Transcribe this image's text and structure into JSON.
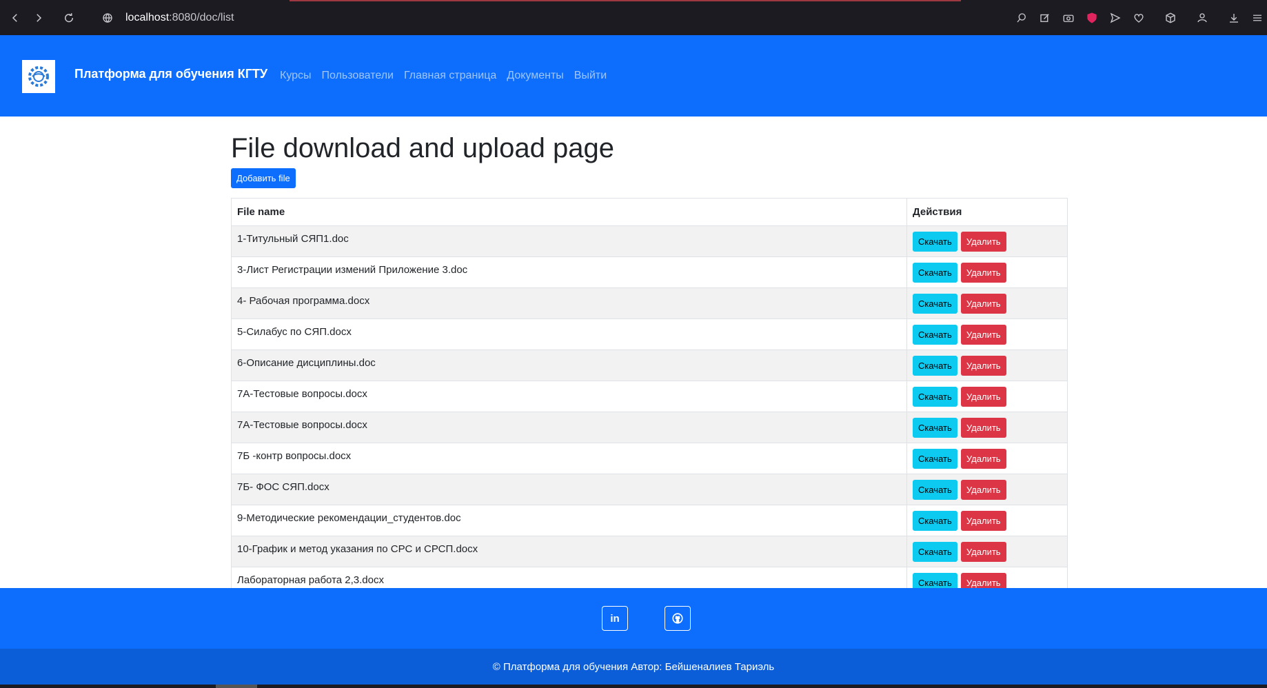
{
  "browser": {
    "url_host": "localhost",
    "url_rest": ":8080/doc/list"
  },
  "navbar": {
    "brand": "Платформа для обучения КГТУ",
    "links": [
      "Курсы",
      "Пользователи",
      "Главная страница",
      "Документы",
      "Выйти"
    ]
  },
  "page": {
    "title": "File download and upload page",
    "add_button": "Добавить file"
  },
  "table": {
    "headers": [
      "File name",
      "Действия"
    ],
    "download_label": "Скачать",
    "delete_label": "Удалить",
    "rows": [
      "1-Титульный СЯП1.doc",
      "3-Лист Регистрации измений Приложение 3.doc",
      "4- Рабочая программа.docx",
      "5-Силабус по СЯП.docx",
      "6-Описание дисциплины.doc",
      "7А-Тестовые вопросы.docx",
      "7А-Тестовые вопросы.docx",
      "7Б -контр вопросы.docx",
      "7Б- ФОС СЯП.docx",
      "9-Методические рекомендации_студентов.doc",
      "10-График и метод указания по СРС и СРСП.docx",
      "Лабораторная работа 2,3.docx"
    ]
  },
  "footer": {
    "social": [
      "linkedin-icon",
      "github-icon"
    ],
    "linkedin_label": "in",
    "copyright": "© Платформа для обучения Автор: Бейшеналиев Тариэль"
  },
  "colors": {
    "primary": "#0d6efd",
    "footer_dark": "#0b5ed7",
    "info": "#0dcaf0",
    "danger": "#dc3545",
    "chrome": "#1c1b22"
  }
}
